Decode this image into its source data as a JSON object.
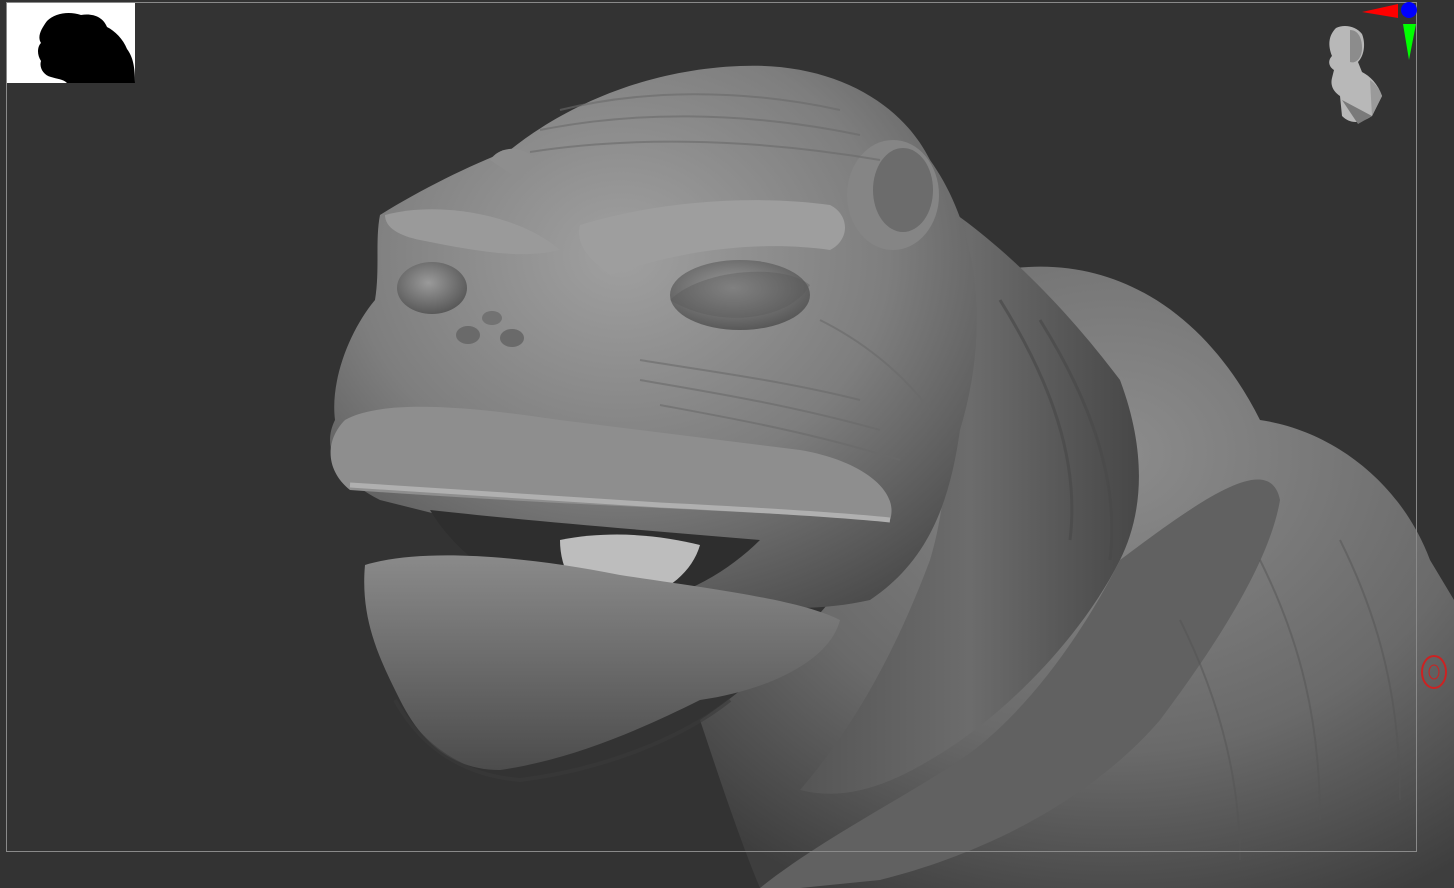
{
  "viewport": {
    "background": "#333333",
    "frame_border_color": "#8a8a8a"
  },
  "thumbnail": {
    "icon": "model-silhouette-icon",
    "background": "#ffffff",
    "silhouette_color": "#000000"
  },
  "model": {
    "icon": "creature-sculpt-icon",
    "base_color": "#7a7a7a"
  },
  "navigation_gizmo": {
    "icon": "head-orientation-gizmo-icon",
    "axis_colors": {
      "x": "#ff0000",
      "y": "#00ff00",
      "z": "#0000ff"
    }
  },
  "brush_cursor": {
    "icon": "brush-circle-cursor-icon",
    "color": "#cc2222"
  }
}
